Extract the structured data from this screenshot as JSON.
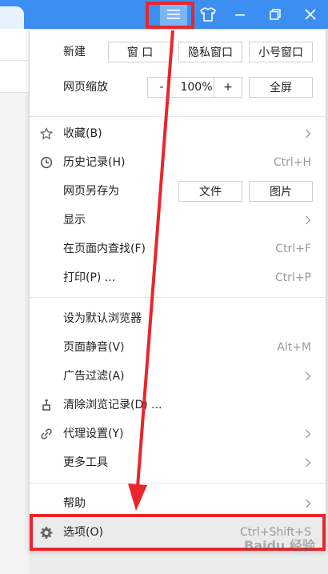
{
  "menu": {
    "new_window": {
      "label": "新建",
      "window": "窗 口",
      "incognito": "隐私窗口",
      "mini": "小号窗口"
    },
    "zoom": {
      "label": "网页缩放",
      "minus": "-",
      "value": "100%",
      "plus": "+",
      "fullscreen": "全屏"
    },
    "items": [
      {
        "label": "收藏(B)",
        "shortcut": "",
        "icon": "star-icon",
        "submenu": true
      },
      {
        "label": "历史记录(H)",
        "shortcut": "Ctrl+H",
        "icon": "clock-icon",
        "submenu": false
      },
      {
        "label": "网页另存为",
        "shortcut": "",
        "icon": "",
        "submenu": false,
        "buttons": [
          "文件",
          "图片"
        ]
      },
      {
        "label": "显示",
        "shortcut": "",
        "icon": "",
        "submenu": true
      },
      {
        "label": "在页面内查找(F)",
        "shortcut": "Ctrl+F",
        "icon": "",
        "submenu": false
      },
      {
        "label": "打印(P) ...",
        "shortcut": "Ctrl+P",
        "icon": "",
        "submenu": false
      },
      {
        "label": "设为默认浏览器",
        "shortcut": "",
        "icon": "",
        "submenu": false
      },
      {
        "label": "页面静音(V)",
        "shortcut": "Alt+M",
        "icon": "",
        "submenu": false
      },
      {
        "label": "广告过滤(A)",
        "shortcut": "",
        "icon": "",
        "submenu": true
      },
      {
        "label": "清除浏览记录(D) ...",
        "shortcut": "",
        "icon": "broom-icon",
        "submenu": false
      },
      {
        "label": "代理设置(Y)",
        "shortcut": "",
        "icon": "link-icon",
        "submenu": true
      },
      {
        "label": "更多工具",
        "shortcut": "",
        "icon": "",
        "submenu": true
      },
      {
        "label": "帮助",
        "shortcut": "",
        "icon": "",
        "submenu": true
      },
      {
        "label": "选项(O)",
        "shortcut": "Ctrl+Shift+S",
        "icon": "gear-icon",
        "submenu": false,
        "selected": true
      }
    ]
  },
  "watermark": "Baidu 经验",
  "colors": {
    "titlebar": "#3c8ff0",
    "highlight": "#e8262c"
  }
}
